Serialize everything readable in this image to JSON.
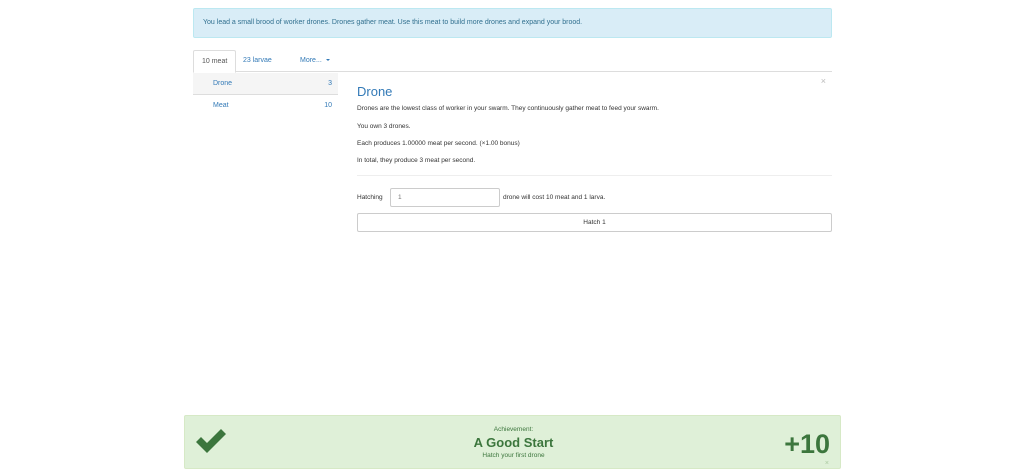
{
  "intro": {
    "message": "You lead a small brood of worker drones. Drones gather meat. Use this meat to build more drones and expand your brood."
  },
  "tabs": [
    {
      "label": "10 meat",
      "active": true
    },
    {
      "label": "23 larvae",
      "active": false
    },
    {
      "label": "More...",
      "active": false
    }
  ],
  "units": [
    {
      "name": "Drone",
      "count": "3",
      "selected": true
    },
    {
      "name": "Meat",
      "count": "10",
      "selected": false
    }
  ],
  "detail": {
    "title": "Drone",
    "close_glyph": "×",
    "description": "Drones are the lowest class of worker in your swarm. They continuously gather meat to feed your swarm.",
    "owned": "You own 3 drones.",
    "production_each": "Each produces 1.00000 meat per second. (×1.00 bonus)",
    "production_total": "In total, they produce 3 meat per second.",
    "hatch_label": "Hatching",
    "hatch_value": "1",
    "hatch_cost": "drone will cost 10 meat and 1 larva.",
    "hatch_button": "Hatch 1"
  },
  "achievement": {
    "label": "Achievement:",
    "title": "A Good Start",
    "description": "Hatch your first drone",
    "points": "+10",
    "close_glyph": "×"
  },
  "colors": {
    "link": "#337ab7",
    "info_bg": "#d9edf7",
    "success_bg": "#dff0d8",
    "success_text": "#3c763d"
  }
}
